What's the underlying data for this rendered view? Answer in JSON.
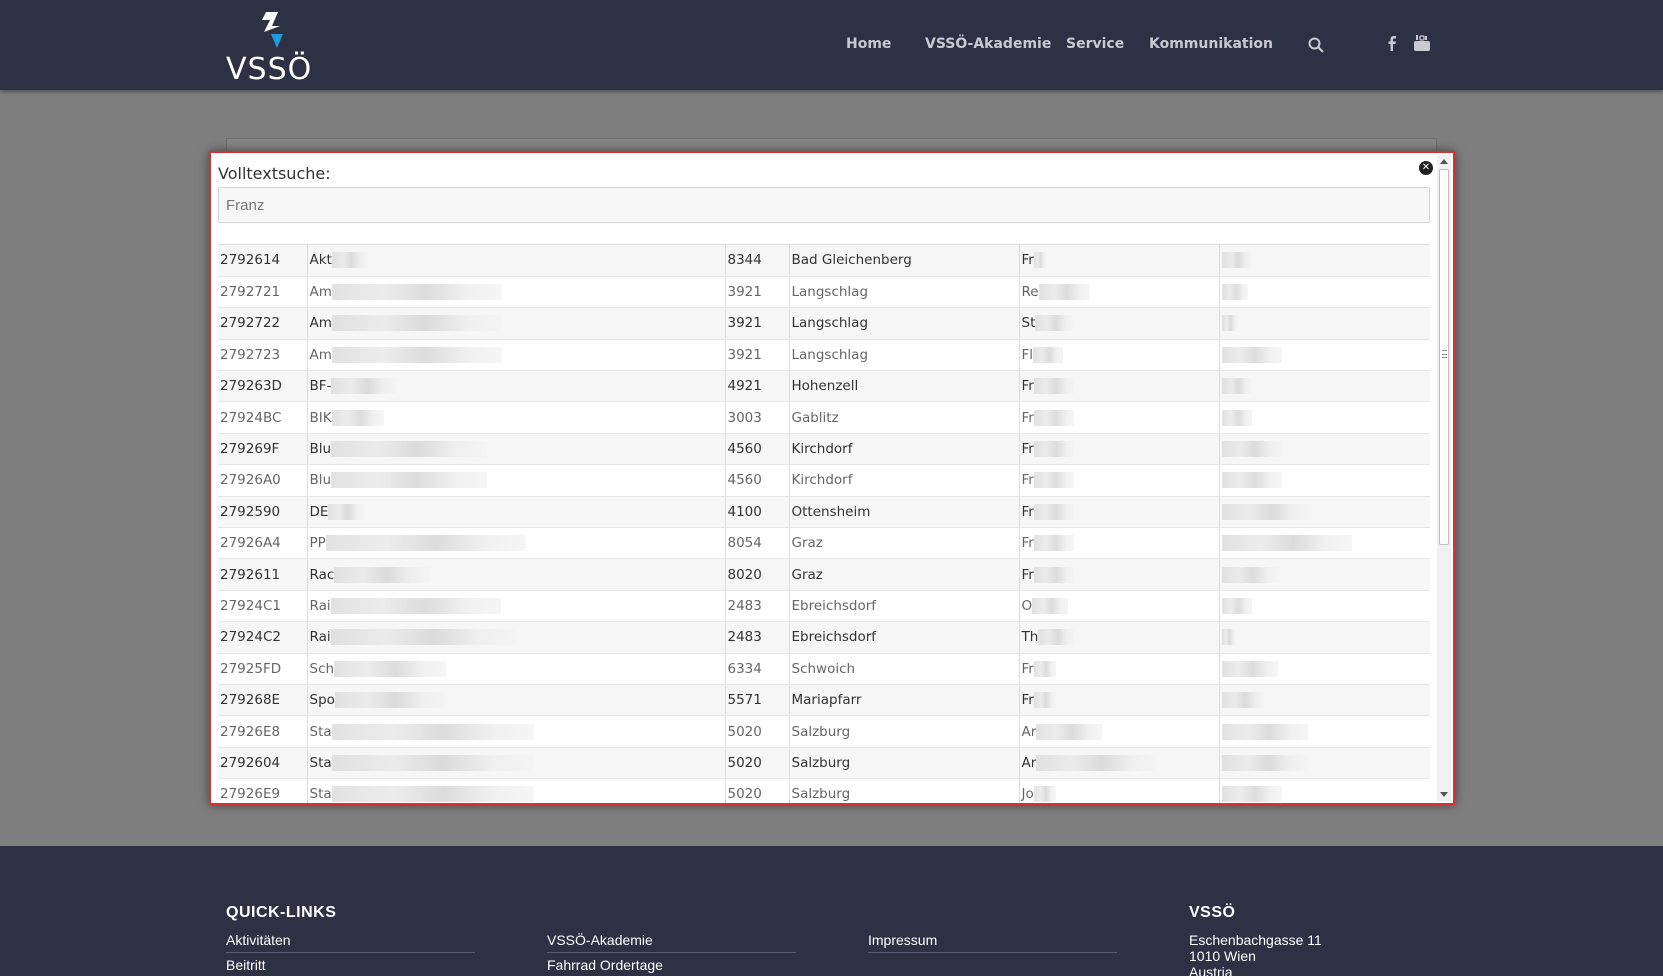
{
  "brand": {
    "name": "VSSÖ"
  },
  "nav": {
    "items": [
      "Home",
      "VSSÖ-Akademie",
      "Service",
      "Kommunikation"
    ]
  },
  "icons": {
    "search": "search-icon",
    "facebook": "facebook-icon",
    "youtube": "youtube-icon",
    "close": "close-icon"
  },
  "colors": {
    "header_bg": "#2e3043",
    "modal_border": "#d9312f",
    "logo_accent": "#1e9bd7"
  },
  "modal": {
    "title": "Volltextsuche:",
    "search_value": "Franz",
    "rows": [
      {
        "id": "2792614",
        "name": "Akt",
        "plz": "8344",
        "ort": "Bad Gleichenberg",
        "contact": "Fr"
      },
      {
        "id": "2792721",
        "name": "Am",
        "plz": "3921",
        "ort": "Langschlag",
        "contact": "Re"
      },
      {
        "id": "2792722",
        "name": "Am",
        "plz": "3921",
        "ort": "Langschlag",
        "contact": "St"
      },
      {
        "id": "2792723",
        "name": "Am",
        "plz": "3921",
        "ort": "Langschlag",
        "contact": "Fl"
      },
      {
        "id": "279263D",
        "name": "BF-",
        "plz": "4921",
        "ort": "Hohenzell",
        "contact": "Fr"
      },
      {
        "id": "27924BC",
        "name": "BIK",
        "plz": "3003",
        "ort": "Gablitz",
        "contact": "Fr"
      },
      {
        "id": "279269F",
        "name": "Blu",
        "plz": "4560",
        "ort": "Kirchdorf",
        "contact": "Fr"
      },
      {
        "id": "27926A0",
        "name": "Blu",
        "plz": "4560",
        "ort": "Kirchdorf",
        "contact": "Fr"
      },
      {
        "id": "2792590",
        "name": "DE",
        "plz": "4100",
        "ort": "Ottensheim",
        "contact": "Fr"
      },
      {
        "id": "27926A4",
        "name": "PP",
        "plz": "8054",
        "ort": "Graz",
        "contact": "Fr"
      },
      {
        "id": "2792611",
        "name": "Rac",
        "plz": "8020",
        "ort": "Graz",
        "contact": "Fr"
      },
      {
        "id": "27924C1",
        "name": "Rai",
        "plz": "2483",
        "ort": "Ebreichsdorf",
        "contact": "O"
      },
      {
        "id": "27924C2",
        "name": "Rai",
        "plz": "2483",
        "ort": "Ebreichsdorf",
        "contact": "Th"
      },
      {
        "id": "27925FD",
        "name": "Sch",
        "plz": "6334",
        "ort": "Schwoich",
        "contact": "Fr"
      },
      {
        "id": "279268E",
        "name": "Spo",
        "plz": "5571",
        "ort": "Mariapfarr",
        "contact": "Fr"
      },
      {
        "id": "27926E8",
        "name": "Sta",
        "plz": "5020",
        "ort": "Salzburg",
        "contact": "Ar"
      },
      {
        "id": "2792604",
        "name": "Sta",
        "plz": "5020",
        "ort": "Salzburg",
        "contact": "Ar"
      },
      {
        "id": "27926E9",
        "name": "Sta",
        "plz": "5020",
        "ort": "Salzburg",
        "contact": "Jo"
      }
    ]
  },
  "footer": {
    "quicklinks_heading": "QUICK-LINKS",
    "col1": [
      "Aktivitäten",
      "Beitritt"
    ],
    "col2": [
      "VSSÖ-Akademie",
      "Fahrrad Ordertage"
    ],
    "col3": [
      "Impressum"
    ],
    "contact_heading": "VSSÖ",
    "address": [
      "Eschenbachgasse 11",
      "1010 Wien",
      "Austria"
    ]
  }
}
